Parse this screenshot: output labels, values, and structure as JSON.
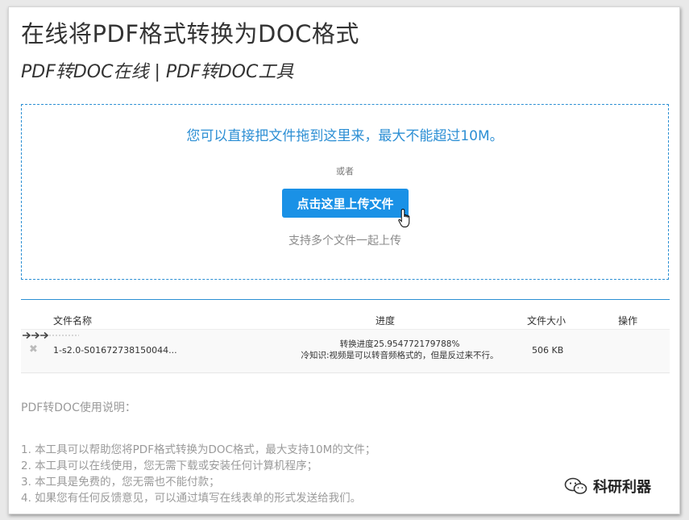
{
  "header": {
    "title": "在线将PDF格式转换为DOC格式",
    "subtitle": "PDF转DOC在线 | PDF转DOC工具"
  },
  "dropzone": {
    "hint": "您可以直接把文件拖到这里来，最大不能超过10M。",
    "or": "或者",
    "upload_button": "点击这里上传文件",
    "multi_hint": "支持多个文件一起上传"
  },
  "table": {
    "columns": [
      "文件名称",
      "进度",
      "文件大小",
      "操作"
    ],
    "rows": [
      {
        "filename": "1-s2.0-S01672738150044...",
        "progress_line1": "转换进度25.954772179788%",
        "progress_line2": "冷知识:视频是可以转音频格式的，但是反过来不行。",
        "size": "506 KB",
        "action_icon": "loading-arrows-icon"
      }
    ]
  },
  "instructions": {
    "title": "PDF转DOC使用说明：",
    "items": [
      "1. 本工具可以帮助您将PDF格式转换为DOC格式，最大支持10M的文件；",
      "2. 本工具可以在线使用，您无需下载或安装任何计算机程序；",
      "3. 本工具是免费的，您无需也不能付款；",
      "4. 如果您有任何反馈意见，可以通过填写在线表单的形式发送给我们。"
    ]
  },
  "watermark": {
    "text": "科研利器",
    "icon": "wechat-icon"
  },
  "colors": {
    "accent": "#2d8fd4",
    "button": "#1a91e6",
    "muted_text": "#9a9a9a"
  }
}
